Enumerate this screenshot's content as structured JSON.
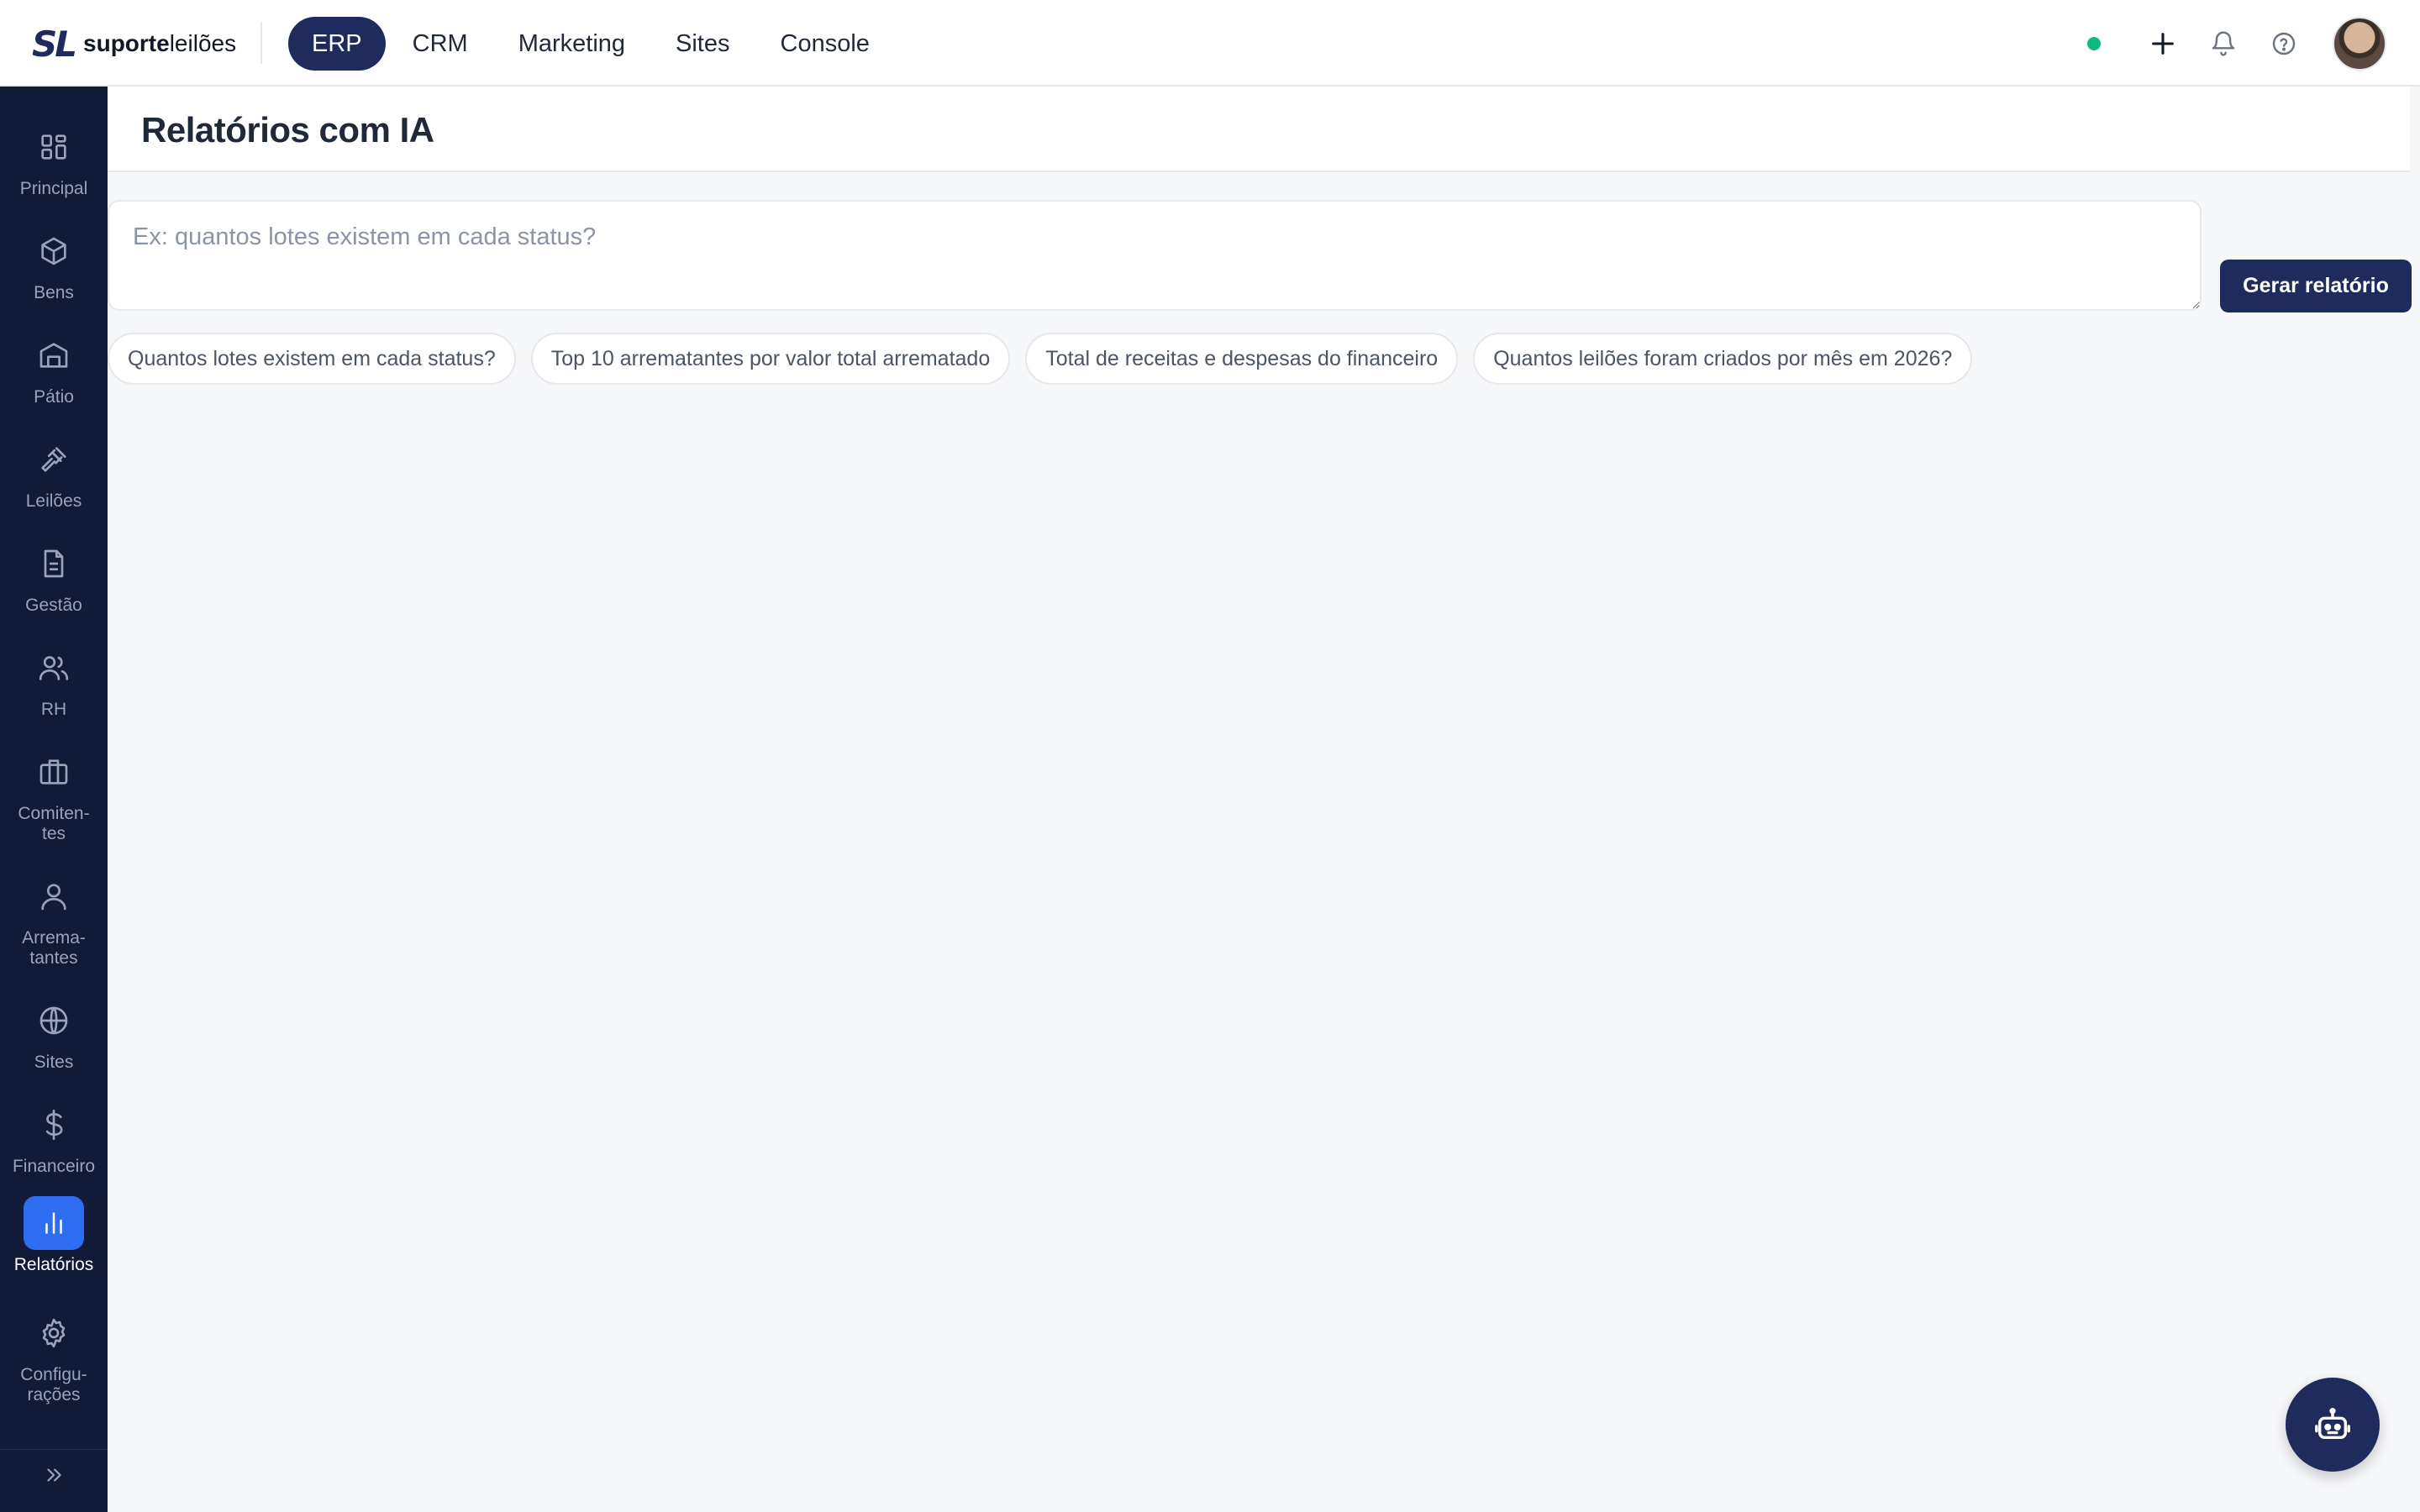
{
  "brand": {
    "mark": "SL",
    "name_bold": "suporte",
    "name_light": "leilões"
  },
  "topnav": [
    {
      "label": "ERP",
      "active": true
    },
    {
      "label": "CRM",
      "active": false
    },
    {
      "label": "Marketing",
      "active": false
    },
    {
      "label": "Sites",
      "active": false
    },
    {
      "label": "Console",
      "active": false
    }
  ],
  "sidebar": {
    "items": [
      {
        "label": "Principal",
        "icon": "grid-icon"
      },
      {
        "label": "Bens",
        "icon": "box-icon"
      },
      {
        "label": "Pátio",
        "icon": "warehouse-icon"
      },
      {
        "label": "Leilões",
        "icon": "gavel-icon"
      },
      {
        "label": "Gestão",
        "icon": "document-icon"
      },
      {
        "label": "RH",
        "icon": "users-icon"
      },
      {
        "label": "Comiten-tes",
        "label_line1": "Comiten-",
        "label_line2": "tes",
        "icon": "briefcase-icon"
      },
      {
        "label": "Arrema-tantes",
        "label_line1": "Arrema-",
        "label_line2": "tantes",
        "icon": "user-icon"
      },
      {
        "label": "Sites",
        "icon": "globe-icon"
      },
      {
        "label": "Financeiro",
        "icon": "dollar-icon"
      },
      {
        "label": "Relatórios",
        "icon": "bar-chart-icon",
        "active": true
      },
      {
        "label": "Configu-rações",
        "label_line1": "Configu-",
        "label_line2": "rações",
        "icon": "gear-icon"
      }
    ]
  },
  "page": {
    "title": "Relatórios com IA"
  },
  "prompt": {
    "placeholder": "Ex: quantos lotes existem em cada status?",
    "value": ""
  },
  "actions": {
    "generate_label": "Gerar relatório"
  },
  "suggestions": [
    "Quantos lotes existem em cada status?",
    "Top 10 arrematantes por valor total arrematado",
    "Total de receitas e despesas do financeiro",
    "Quantos leilões foram criados por mês em 2026?"
  ],
  "colors": {
    "primary": "#1e2b5c",
    "sidebar_bg": "#111a36",
    "accent_active": "#2f6df0",
    "status_online": "#10b981"
  }
}
